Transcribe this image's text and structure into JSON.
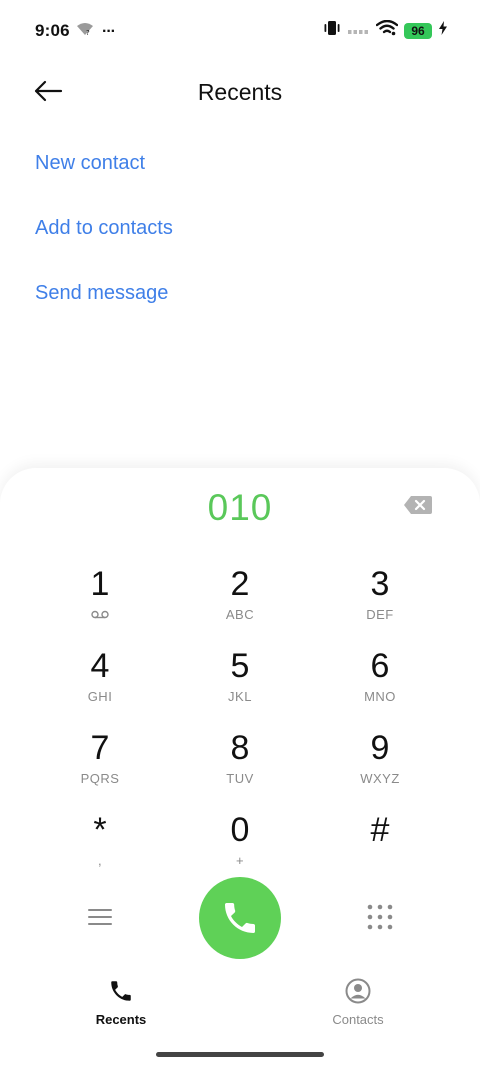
{
  "status_bar": {
    "time": "9:06",
    "more": "···",
    "battery": "96"
  },
  "header": {
    "title": "Recents"
  },
  "actions": [
    {
      "label": "New contact"
    },
    {
      "label": "Add to contacts"
    },
    {
      "label": "Send message"
    }
  ],
  "dialer": {
    "number": "010",
    "keys": [
      {
        "digit": "1",
        "letters": "",
        "icon": "voicemail-icon"
      },
      {
        "digit": "2",
        "letters": "ABC"
      },
      {
        "digit": "3",
        "letters": "DEF"
      },
      {
        "digit": "4",
        "letters": "GHI"
      },
      {
        "digit": "5",
        "letters": "JKL"
      },
      {
        "digit": "6",
        "letters": "MNO"
      },
      {
        "digit": "7",
        "letters": "PQRS"
      },
      {
        "digit": "8",
        "letters": "TUV"
      },
      {
        "digit": "9",
        "letters": "WXYZ"
      },
      {
        "digit": "*",
        "letters": ","
      },
      {
        "digit": "0",
        "letters": "+"
      },
      {
        "digit": "#",
        "letters": ""
      }
    ]
  },
  "nav": {
    "recents": "Recents",
    "contacts": "Contacts"
  },
  "colors": {
    "accent_link": "#3f7fe8",
    "dial_number": "#5ac85a",
    "call_button": "#5fd157",
    "battery": "#34c759"
  }
}
